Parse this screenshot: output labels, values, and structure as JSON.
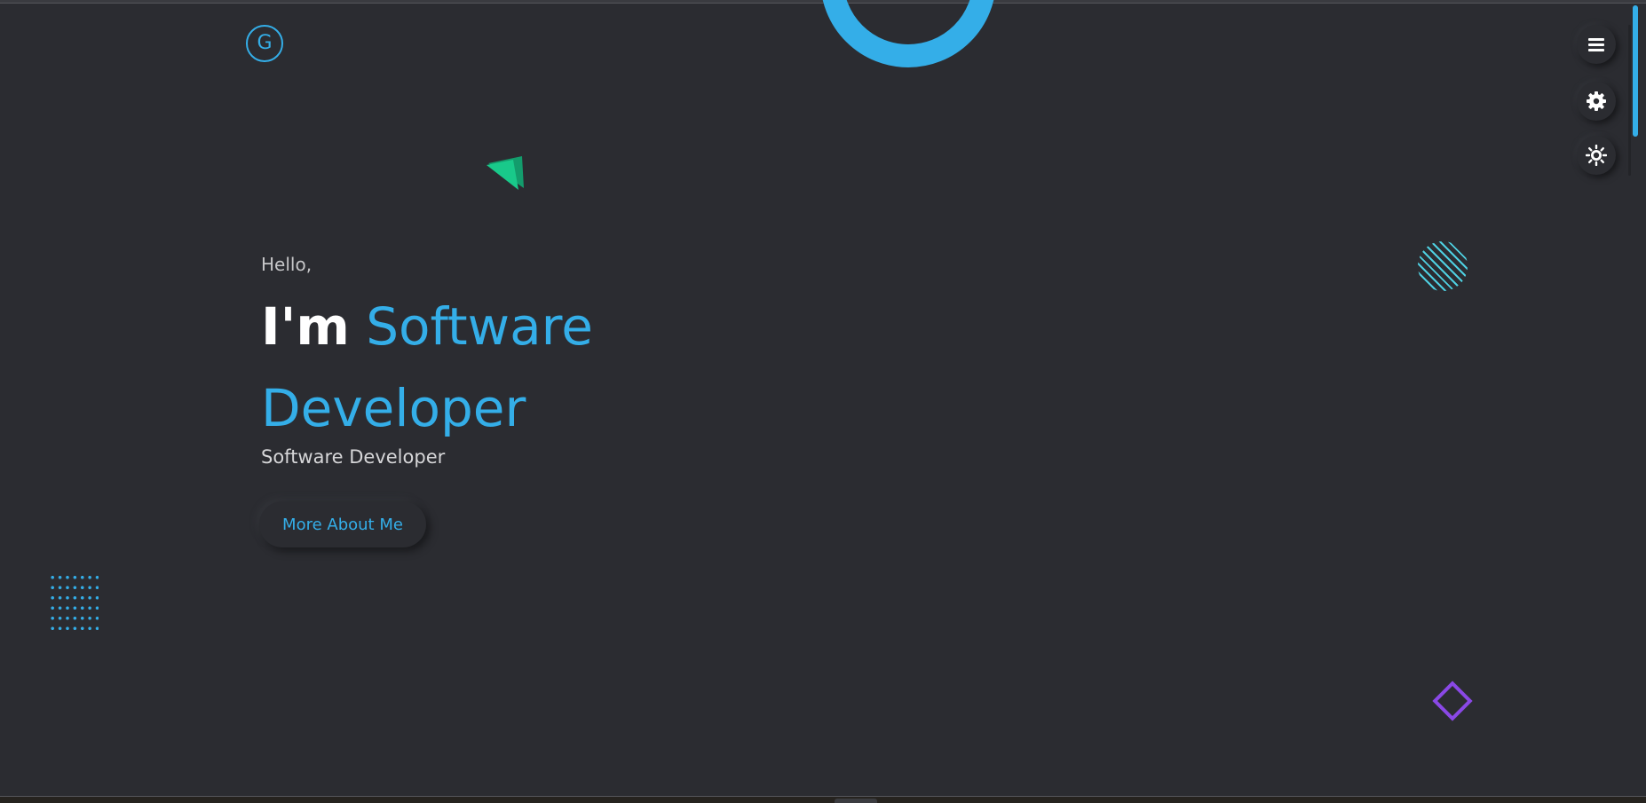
{
  "logo": {
    "letter": "G"
  },
  "hero": {
    "greeting": "Hello,",
    "headline_prefix": "I'm",
    "headline_highlight": "Software Developer",
    "subtitle": "Software Developer",
    "cta_label": "More About Me"
  },
  "side_menu": {
    "items": [
      {
        "icon": "menu-icon"
      },
      {
        "icon": "settings-gear-icon"
      },
      {
        "icon": "theme-toggle-sun-icon"
      }
    ]
  },
  "colors": {
    "background": "#2b2c31",
    "accent": "#34aee8",
    "triangle": "#19c98a",
    "diamond": "#8a48e6",
    "stripes": "#4ecfe0"
  }
}
